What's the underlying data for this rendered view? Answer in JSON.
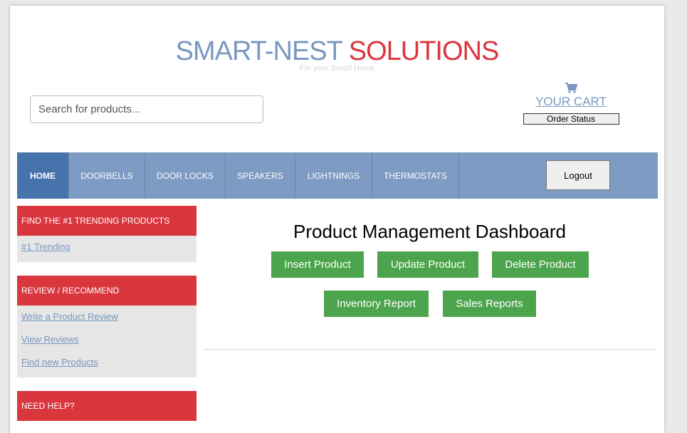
{
  "brand": {
    "part1": "SMART-NEST",
    "part2": "SOLUTIONS",
    "tagline": "For your Smart Home"
  },
  "search": {
    "placeholder": "Search for products..."
  },
  "cart": {
    "label": "YOUR CART",
    "order_status": "Order Status"
  },
  "nav": {
    "items": [
      "HOME",
      "DOORBELLS",
      "DOOR LOCKS",
      "SPEAKERS",
      "LIGHTNINGS",
      "THERMOSTATS"
    ],
    "logout": "Logout"
  },
  "sidebar": {
    "trending": {
      "title": "FIND THE #1 TRENDING PRODUCTS",
      "links": [
        "#1 Trending"
      ]
    },
    "review": {
      "title": "REVIEW / RECOMMEND",
      "links": [
        "Write a Product Review",
        "View Reviews",
        "Find new Products"
      ]
    },
    "help": {
      "title": "NEED HELP?"
    }
  },
  "main": {
    "title": "Product Management Dashboard",
    "buttons": [
      "Insert Product",
      "Update Product",
      "Delete Product",
      "Inventory Report",
      "Sales Reports"
    ]
  },
  "colors": {
    "brand_blue": "#7897c1",
    "brand_red": "#d9363e",
    "nav_bg": "#7d9bc3",
    "nav_active": "#4773ad",
    "button_green": "#4ca54c"
  }
}
